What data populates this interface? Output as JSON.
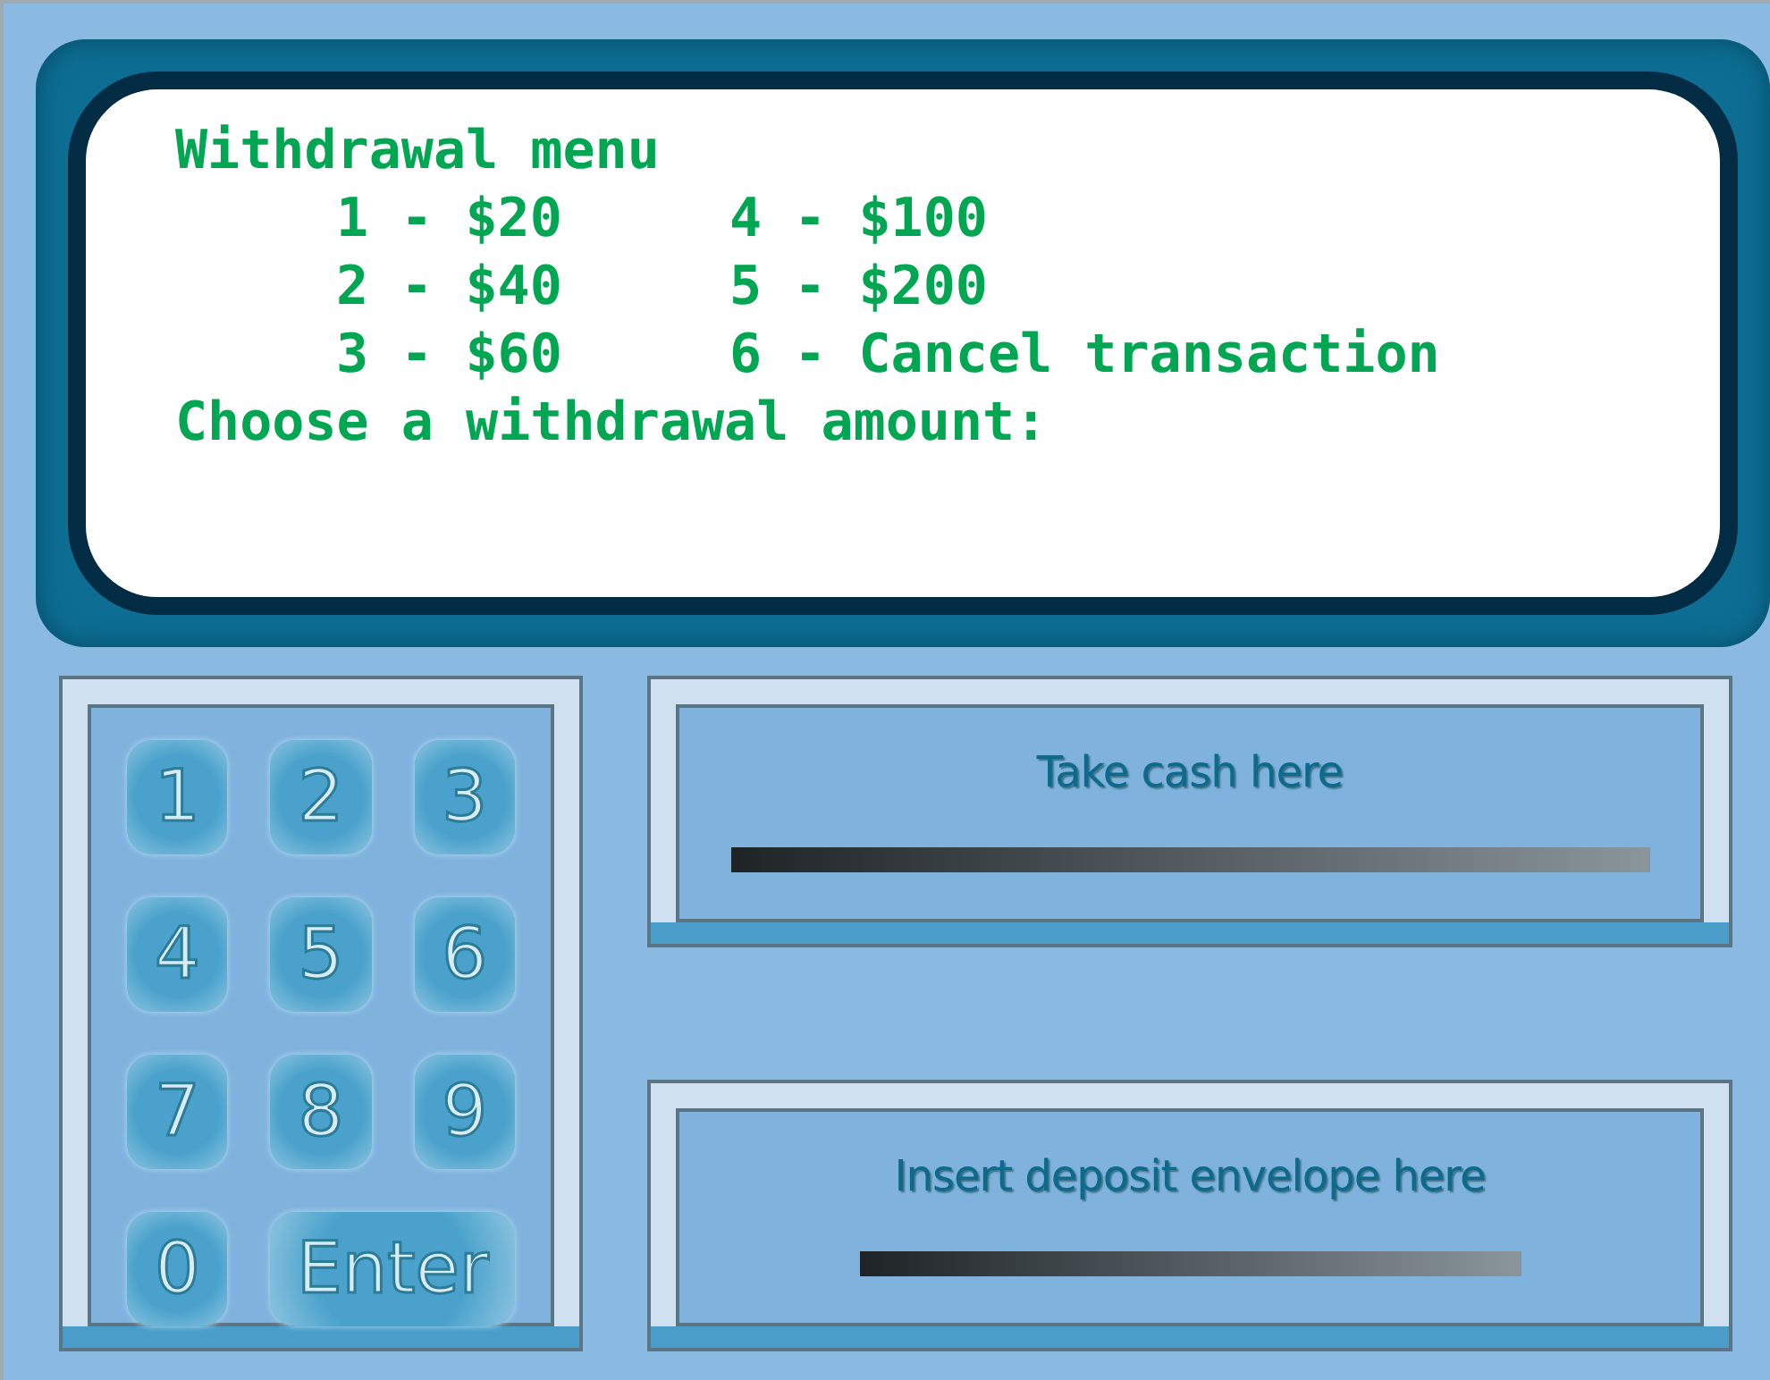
{
  "screen": {
    "heading": "Withdrawal menu",
    "options": [
      "1 - $20",
      "2 - $40",
      "3 - $60",
      "4 - $100",
      "5 - $200",
      "6 - Cancel transaction"
    ],
    "prompt": "Choose a withdrawal amount:"
  },
  "keypad": [
    {
      "label": "1",
      "kind": "digit"
    },
    {
      "label": "2",
      "kind": "digit"
    },
    {
      "label": "3",
      "kind": "digit"
    },
    {
      "label": "4",
      "kind": "digit"
    },
    {
      "label": "5",
      "kind": "digit"
    },
    {
      "label": "6",
      "kind": "digit"
    },
    {
      "label": "7",
      "kind": "digit"
    },
    {
      "label": "8",
      "kind": "digit"
    },
    {
      "label": "9",
      "kind": "digit"
    },
    {
      "label": "0",
      "kind": "digit"
    },
    {
      "label": "Enter",
      "kind": "enter"
    }
  ],
  "slots": [
    {
      "label": "Take cash here",
      "kind": "cash"
    },
    {
      "label": "Insert deposit envelope here",
      "kind": "deposit"
    }
  ]
}
